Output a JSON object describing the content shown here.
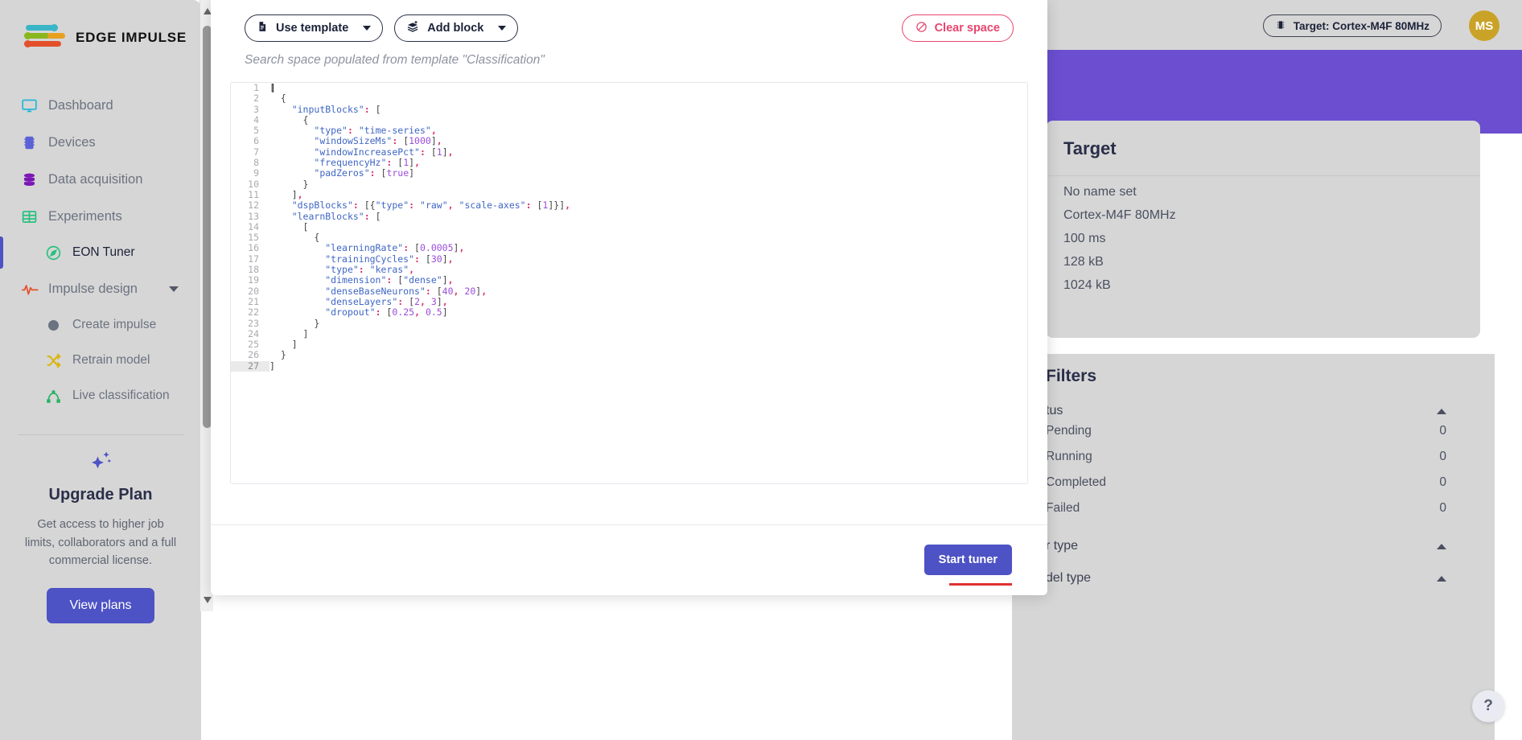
{
  "sidebar": {
    "brand": "EDGE IMPULSE",
    "items": [
      {
        "label": "Dashboard",
        "icon": "monitor-icon",
        "type": "top"
      },
      {
        "label": "Devices",
        "icon": "chip-icon",
        "type": "top"
      },
      {
        "label": "Data acquisition",
        "icon": "database-icon",
        "type": "top"
      },
      {
        "label": "Experiments",
        "icon": "grid-icon",
        "type": "top"
      },
      {
        "label": "EON Tuner",
        "icon": "compass-icon",
        "type": "sub",
        "active": true
      },
      {
        "label": "Impulse design",
        "icon": "pulse-icon",
        "type": "top",
        "expandable": true
      },
      {
        "label": "Create impulse",
        "icon": "dot-icon",
        "type": "sub"
      },
      {
        "label": "Retrain model",
        "icon": "shuffle-icon",
        "type": "sub"
      },
      {
        "label": "Live classification",
        "icon": "nodes-icon",
        "type": "sub"
      }
    ],
    "upgrade": {
      "icon": "sparkle-star-icon",
      "title": "Upgrade Plan",
      "text": "Get access to higher job limits, collaborators and a full commercial license.",
      "button": "View plans"
    }
  },
  "topbar": {
    "target_pill": "Target: Cortex-M4F 80MHz",
    "target_icon": "chip-icon",
    "avatar_initials": "MS"
  },
  "target_panel": {
    "title": "Target",
    "rows": [
      "No name set",
      "Cortex-M4F 80MHz",
      "100 ms",
      "128 kB",
      "1024 kB"
    ]
  },
  "filters_panel": {
    "title": "Filters",
    "groups": [
      {
        "label": "tus",
        "rows": [
          {
            "label": "Pending",
            "count": "0"
          },
          {
            "label": "Running",
            "count": "0"
          },
          {
            "label": "Completed",
            "count": "0"
          },
          {
            "label": "Failed",
            "count": "0"
          }
        ]
      },
      {
        "label": "r type",
        "rows": []
      },
      {
        "label": "del type",
        "rows": []
      }
    ]
  },
  "modal": {
    "toolbar": {
      "use_template": "Use template",
      "use_template_icon": "document-icon",
      "add_block": "Add block",
      "add_block_icon": "layers-plus-icon",
      "clear_space": "Clear space",
      "clear_space_icon": "no-entry-icon"
    },
    "subtitle": "Search space populated from template \"Classification\"",
    "footer": {
      "start_tuner": "Start tuner"
    },
    "editor": {
      "lines": [
        {
          "n": "1",
          "tokens": [
            {
              "t": "p",
              "v": "["
            }
          ],
          "caret": true
        },
        {
          "n": "2",
          "tokens": [
            {
              "t": "p",
              "v": "  {"
            }
          ]
        },
        {
          "n": "3",
          "tokens": [
            {
              "t": "p",
              "v": "    "
            },
            {
              "t": "key",
              "v": "\"inputBlocks\""
            },
            {
              "t": "c",
              "v": ":"
            },
            {
              "t": "p",
              "v": " ["
            }
          ]
        },
        {
          "n": "4",
          "tokens": [
            {
              "t": "p",
              "v": "      {"
            }
          ]
        },
        {
          "n": "5",
          "tokens": [
            {
              "t": "p",
              "v": "        "
            },
            {
              "t": "key",
              "v": "\"type\""
            },
            {
              "t": "c",
              "v": ":"
            },
            {
              "t": "p",
              "v": " "
            },
            {
              "t": "str",
              "v": "\"time-series\""
            },
            {
              "t": "c",
              "v": ","
            }
          ]
        },
        {
          "n": "6",
          "tokens": [
            {
              "t": "p",
              "v": "        "
            },
            {
              "t": "key",
              "v": "\"windowSizeMs\""
            },
            {
              "t": "c",
              "v": ":"
            },
            {
              "t": "p",
              "v": " ["
            },
            {
              "t": "num",
              "v": "1000"
            },
            {
              "t": "p",
              "v": "]"
            },
            {
              "t": "c",
              "v": ","
            }
          ]
        },
        {
          "n": "7",
          "tokens": [
            {
              "t": "p",
              "v": "        "
            },
            {
              "t": "key",
              "v": "\"windowIncreasePct\""
            },
            {
              "t": "c",
              "v": ":"
            },
            {
              "t": "p",
              "v": " ["
            },
            {
              "t": "num",
              "v": "1"
            },
            {
              "t": "p",
              "v": "]"
            },
            {
              "t": "c",
              "v": ","
            }
          ]
        },
        {
          "n": "8",
          "tokens": [
            {
              "t": "p",
              "v": "        "
            },
            {
              "t": "key",
              "v": "\"frequencyHz\""
            },
            {
              "t": "c",
              "v": ":"
            },
            {
              "t": "p",
              "v": " ["
            },
            {
              "t": "num",
              "v": "1"
            },
            {
              "t": "p",
              "v": "]"
            },
            {
              "t": "c",
              "v": ","
            }
          ]
        },
        {
          "n": "9",
          "tokens": [
            {
              "t": "p",
              "v": "        "
            },
            {
              "t": "key",
              "v": "\"padZeros\""
            },
            {
              "t": "c",
              "v": ":"
            },
            {
              "t": "p",
              "v": " ["
            },
            {
              "t": "bool",
              "v": "true"
            },
            {
              "t": "p",
              "v": "]"
            }
          ]
        },
        {
          "n": "10",
          "tokens": [
            {
              "t": "p",
              "v": "      }"
            }
          ]
        },
        {
          "n": "11",
          "tokens": [
            {
              "t": "p",
              "v": "    ]"
            },
            {
              "t": "c",
              "v": ","
            }
          ]
        },
        {
          "n": "12",
          "tokens": [
            {
              "t": "p",
              "v": "    "
            },
            {
              "t": "key",
              "v": "\"dspBlocks\""
            },
            {
              "t": "c",
              "v": ":"
            },
            {
              "t": "p",
              "v": " [{"
            },
            {
              "t": "key",
              "v": "\"type\""
            },
            {
              "t": "c",
              "v": ":"
            },
            {
              "t": "p",
              "v": " "
            },
            {
              "t": "str",
              "v": "\"raw\""
            },
            {
              "t": "c",
              "v": ","
            },
            {
              "t": "p",
              "v": " "
            },
            {
              "t": "key",
              "v": "\"scale-axes\""
            },
            {
              "t": "c",
              "v": ":"
            },
            {
              "t": "p",
              "v": " ["
            },
            {
              "t": "num",
              "v": "1"
            },
            {
              "t": "p",
              "v": "]}]"
            },
            {
              "t": "c",
              "v": ","
            }
          ]
        },
        {
          "n": "13",
          "tokens": [
            {
              "t": "p",
              "v": "    "
            },
            {
              "t": "key",
              "v": "\"learnBlocks\""
            },
            {
              "t": "c",
              "v": ":"
            },
            {
              "t": "p",
              "v": " ["
            }
          ]
        },
        {
          "n": "14",
          "tokens": [
            {
              "t": "p",
              "v": "      ["
            }
          ]
        },
        {
          "n": "15",
          "tokens": [
            {
              "t": "p",
              "v": "        {"
            }
          ]
        },
        {
          "n": "16",
          "tokens": [
            {
              "t": "p",
              "v": "          "
            },
            {
              "t": "key",
              "v": "\"learningRate\""
            },
            {
              "t": "c",
              "v": ":"
            },
            {
              "t": "p",
              "v": " ["
            },
            {
              "t": "num",
              "v": "0.0005"
            },
            {
              "t": "p",
              "v": "]"
            },
            {
              "t": "c",
              "v": ","
            }
          ]
        },
        {
          "n": "17",
          "tokens": [
            {
              "t": "p",
              "v": "          "
            },
            {
              "t": "key",
              "v": "\"trainingCycles\""
            },
            {
              "t": "c",
              "v": ":"
            },
            {
              "t": "p",
              "v": " ["
            },
            {
              "t": "num",
              "v": "30"
            },
            {
              "t": "p",
              "v": "]"
            },
            {
              "t": "c",
              "v": ","
            }
          ]
        },
        {
          "n": "18",
          "tokens": [
            {
              "t": "p",
              "v": "          "
            },
            {
              "t": "key",
              "v": "\"type\""
            },
            {
              "t": "c",
              "v": ":"
            },
            {
              "t": "p",
              "v": " "
            },
            {
              "t": "str",
              "v": "\"keras\""
            },
            {
              "t": "c",
              "v": ","
            }
          ]
        },
        {
          "n": "19",
          "tokens": [
            {
              "t": "p",
              "v": "          "
            },
            {
              "t": "key",
              "v": "\"dimension\""
            },
            {
              "t": "c",
              "v": ":"
            },
            {
              "t": "p",
              "v": " ["
            },
            {
              "t": "str",
              "v": "\"dense\""
            },
            {
              "t": "p",
              "v": "]"
            },
            {
              "t": "c",
              "v": ","
            }
          ]
        },
        {
          "n": "20",
          "tokens": [
            {
              "t": "p",
              "v": "          "
            },
            {
              "t": "key",
              "v": "\"denseBaseNeurons\""
            },
            {
              "t": "c",
              "v": ":"
            },
            {
              "t": "p",
              "v": " ["
            },
            {
              "t": "num",
              "v": "40"
            },
            {
              "t": "c",
              "v": ","
            },
            {
              "t": "p",
              "v": " "
            },
            {
              "t": "num",
              "v": "20"
            },
            {
              "t": "p",
              "v": "]"
            },
            {
              "t": "c",
              "v": ","
            }
          ]
        },
        {
          "n": "21",
          "tokens": [
            {
              "t": "p",
              "v": "          "
            },
            {
              "t": "key",
              "v": "\"denseLayers\""
            },
            {
              "t": "c",
              "v": ":"
            },
            {
              "t": "p",
              "v": " ["
            },
            {
              "t": "num",
              "v": "2"
            },
            {
              "t": "c",
              "v": ","
            },
            {
              "t": "p",
              "v": " "
            },
            {
              "t": "num",
              "v": "3"
            },
            {
              "t": "p",
              "v": "]"
            },
            {
              "t": "c",
              "v": ","
            }
          ]
        },
        {
          "n": "22",
          "tokens": [
            {
              "t": "p",
              "v": "          "
            },
            {
              "t": "key",
              "v": "\"dropout\""
            },
            {
              "t": "c",
              "v": ":"
            },
            {
              "t": "p",
              "v": " ["
            },
            {
              "t": "num",
              "v": "0.25"
            },
            {
              "t": "c",
              "v": ","
            },
            {
              "t": "p",
              "v": " "
            },
            {
              "t": "num",
              "v": "0.5"
            },
            {
              "t": "p",
              "v": "]"
            }
          ]
        },
        {
          "n": "23",
          "tokens": [
            {
              "t": "p",
              "v": "        }"
            }
          ]
        },
        {
          "n": "24",
          "tokens": [
            {
              "t": "p",
              "v": "      ]"
            }
          ]
        },
        {
          "n": "25",
          "tokens": [
            {
              "t": "p",
              "v": "    ]"
            }
          ]
        },
        {
          "n": "26",
          "tokens": [
            {
              "t": "p",
              "v": "  }"
            }
          ]
        },
        {
          "n": "27",
          "tokens": [
            {
              "t": "p",
              "v": "]"
            }
          ],
          "gutter_hl": true
        }
      ]
    }
  },
  "help": {
    "label": "?"
  },
  "colors": {
    "accent": "#4d52c4",
    "danger": "#e8456e",
    "purple_band": "#6b4fd0",
    "sidebar_bg": "#d6d6d6",
    "avatar": "#c9a227"
  }
}
